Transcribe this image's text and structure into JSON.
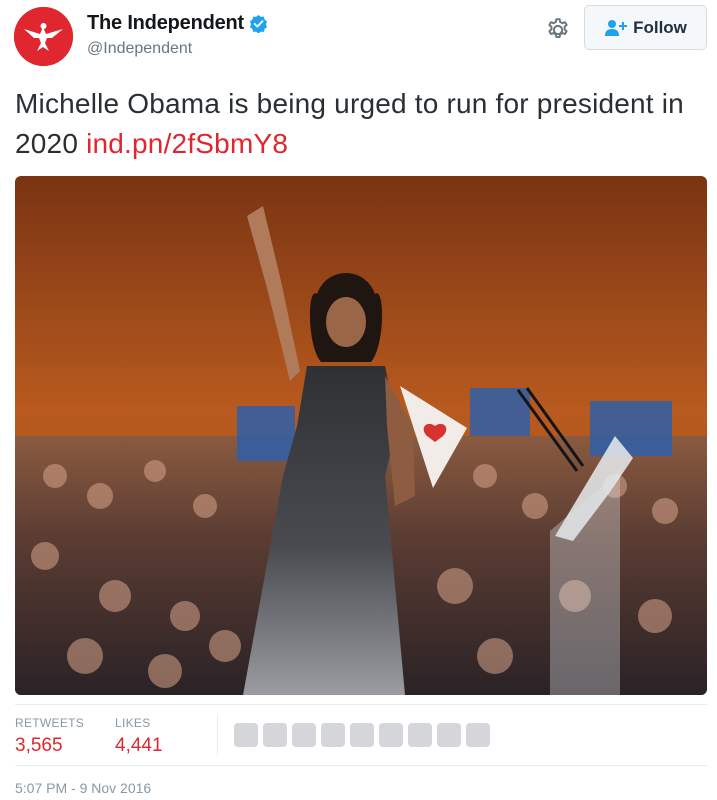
{
  "author": {
    "display_name": "The Independent",
    "handle": "@Independent",
    "avatar_icon": "eagle-logo-icon",
    "verified_icon": "verified-badge-icon",
    "brand_color": "#e0262f"
  },
  "actions": {
    "settings_icon": "gear-icon",
    "follow_icon": "add-user-icon",
    "follow_label": "Follow"
  },
  "tweet": {
    "text": "Michelle Obama is being urged to run for president in 2020 ",
    "link": "ind.pn/2fSbmY8",
    "link_color": "#e0262f"
  },
  "stats": {
    "retweets_label": "RETWEETS",
    "retweets_value": "3,565",
    "likes_label": "LIKES",
    "likes_value": "4,441",
    "value_color": "#e0262f"
  },
  "liker_avatars": [
    "liker-1",
    "liker-2",
    "liker-3",
    "liker-4",
    "liker-5",
    "liker-6",
    "liker-7",
    "liker-8",
    "liker-9",
    "liker-10",
    "liker-11"
  ],
  "timestamp": "5:07 PM - 9 Nov 2016"
}
